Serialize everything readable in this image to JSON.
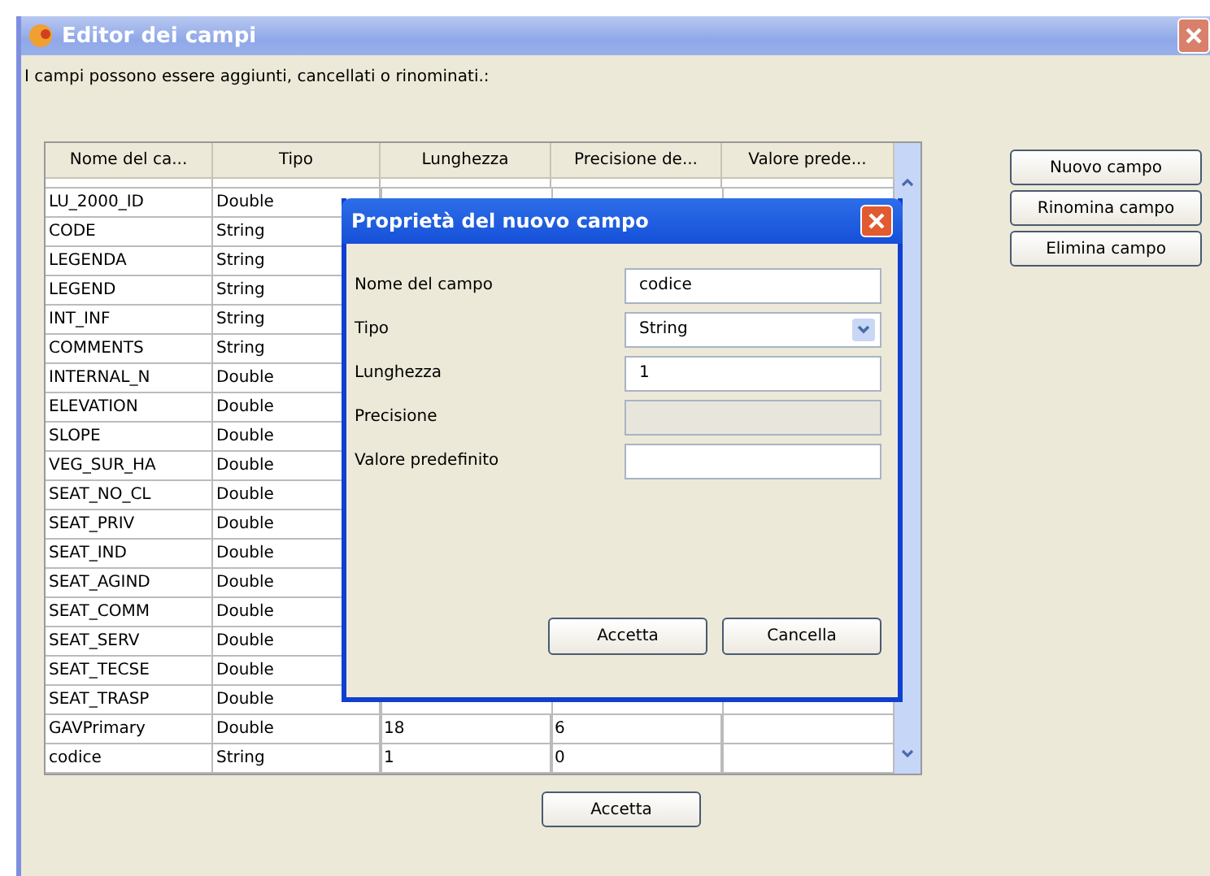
{
  "window": {
    "title": "Editor dei campi"
  },
  "intro": "I campi possono essere aggiunti, cancellati o rinominati.:",
  "table": {
    "columns": [
      "Nome del ca...",
      "Tipo",
      "Lunghezza",
      "Precisione de...",
      "Valore prede..."
    ],
    "rows": [
      {
        "name": "LU_2000_ID",
        "type": "Double"
      },
      {
        "name": "CODE",
        "type": "String"
      },
      {
        "name": "LEGENDA",
        "type": "String"
      },
      {
        "name": "LEGEND",
        "type": "String"
      },
      {
        "name": "INT_INF",
        "type": "String"
      },
      {
        "name": "COMMENTS",
        "type": "String"
      },
      {
        "name": "INTERNAL_N",
        "type": "Double"
      },
      {
        "name": "ELEVATION",
        "type": "Double"
      },
      {
        "name": "SLOPE",
        "type": "Double"
      },
      {
        "name": "VEG_SUR_HA",
        "type": "Double"
      },
      {
        "name": "SEAT_NO_CL",
        "type": "Double"
      },
      {
        "name": "SEAT_PRIV",
        "type": "Double"
      },
      {
        "name": "SEAT_IND",
        "type": "Double"
      },
      {
        "name": "SEAT_AGIND",
        "type": "Double"
      },
      {
        "name": "SEAT_COMM",
        "type": "Double"
      },
      {
        "name": "SEAT_SERV",
        "type": "Double"
      },
      {
        "name": "SEAT_TECSE",
        "type": "Double"
      },
      {
        "name": "SEAT_TRASP",
        "type": "Double"
      },
      {
        "name": "GAVPrimary",
        "type": "Double",
        "length": "18",
        "precision": "6"
      },
      {
        "name": "codice",
        "type": "String",
        "length": "1",
        "precision": "0"
      }
    ]
  },
  "side_buttons": [
    "Nuovo campo",
    "Rinomina campo",
    "Elimina campo"
  ],
  "dialog": {
    "title": "Proprietà del nuovo campo",
    "fields": [
      {
        "label": "Nome del campo",
        "kind": "text",
        "value": "codice",
        "disabled": false
      },
      {
        "label": "Tipo",
        "kind": "select",
        "value": "String",
        "disabled": false
      },
      {
        "label": "Lunghezza",
        "kind": "text",
        "value": "1",
        "disabled": false
      },
      {
        "label": "Precisione",
        "kind": "text",
        "disabled": true
      },
      {
        "label": "Valore predefinito",
        "kind": "text",
        "disabled": false
      }
    ],
    "buttons": [
      "Accetta",
      "Cancella"
    ]
  },
  "ok_button": "Accetta"
}
